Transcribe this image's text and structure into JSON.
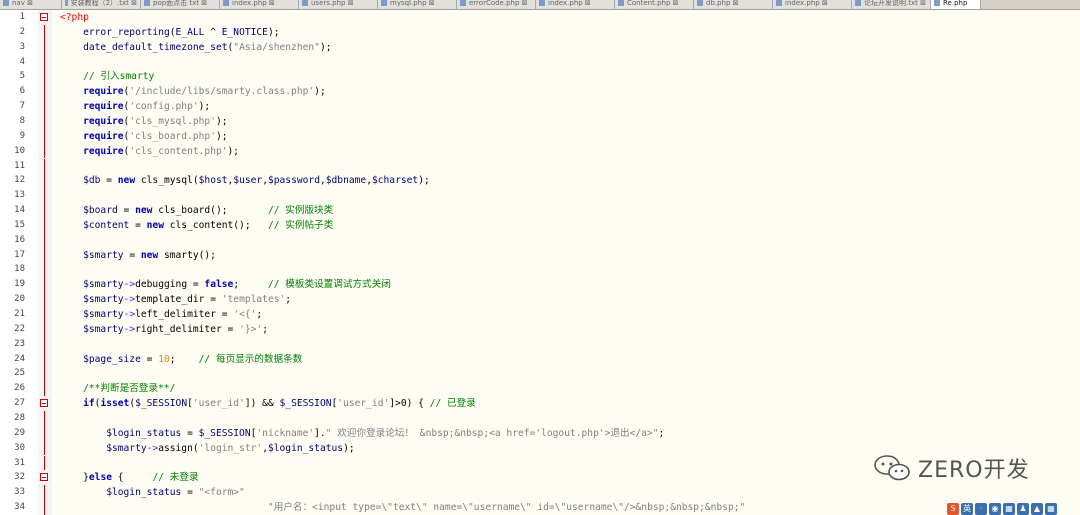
{
  "tabs": [
    {
      "label": "nav ⊠",
      "active": false
    },
    {
      "label": "安装教程（2）.txt ⊠",
      "active": false
    },
    {
      "label": "pop面点击 txt ⊠",
      "active": false
    },
    {
      "label": "index.php ⊠",
      "active": false
    },
    {
      "label": "users.php ⊠",
      "active": false
    },
    {
      "label": "mysql.php ⊠",
      "active": false
    },
    {
      "label": "errorCode.php ⊠",
      "active": false
    },
    {
      "label": "index.php ⊠",
      "active": false
    },
    {
      "label": "Content.php ⊠",
      "active": false
    },
    {
      "label": "db.php ⊠",
      "active": false
    },
    {
      "label": "index.php ⊠",
      "active": false
    },
    {
      "label": "论坛开发说明.txt ⊠",
      "active": false
    },
    {
      "label": "Re.php",
      "active": true
    }
  ],
  "lines": [
    {
      "n": "1",
      "segs": [
        [
          "tag",
          "<?php"
        ]
      ]
    },
    {
      "n": "2",
      "segs": [
        [
          "fn",
          "    error_reporting"
        ],
        [
          "",
          "("
        ],
        [
          "fn",
          "E_ALL"
        ],
        [
          "",
          " ^ "
        ],
        [
          "fn",
          "E_NOTICE"
        ],
        [
          "",
          ");"
        ]
      ]
    },
    {
      "n": "3",
      "segs": [
        [
          "fn",
          "    date_default_timezone_set"
        ],
        [
          "",
          "("
        ],
        [
          "str",
          "\"Asia/shenzhen\""
        ],
        [
          "",
          ");"
        ]
      ]
    },
    {
      "n": "4",
      "segs": []
    },
    {
      "n": "5",
      "segs": [
        [
          "cm",
          "    // 引入smarty"
        ]
      ]
    },
    {
      "n": "6",
      "segs": [
        [
          "kw",
          "    require"
        ],
        [
          "",
          "("
        ],
        [
          "str",
          "'/include/libs/smarty.class.php'"
        ],
        [
          "",
          ");"
        ]
      ]
    },
    {
      "n": "7",
      "segs": [
        [
          "kw",
          "    require"
        ],
        [
          "",
          "("
        ],
        [
          "str",
          "'config.php'"
        ],
        [
          "",
          ");"
        ]
      ]
    },
    {
      "n": "8",
      "segs": [
        [
          "kw",
          "    require"
        ],
        [
          "",
          "("
        ],
        [
          "str",
          "'cls_mysql.php'"
        ],
        [
          "",
          ");"
        ]
      ]
    },
    {
      "n": "9",
      "segs": [
        [
          "kw",
          "    require"
        ],
        [
          "",
          "("
        ],
        [
          "str",
          "'cls_board.php'"
        ],
        [
          "",
          ");"
        ]
      ]
    },
    {
      "n": "10",
      "segs": [
        [
          "kw",
          "    require"
        ],
        [
          "",
          "("
        ],
        [
          "str",
          "'cls_content.php'"
        ],
        [
          "",
          ");"
        ]
      ]
    },
    {
      "n": "11",
      "segs": []
    },
    {
      "n": "12",
      "segs": [
        [
          "var",
          "    $db"
        ],
        [
          "",
          " = "
        ],
        [
          "kw",
          "new"
        ],
        [
          "",
          " cls_mysql("
        ],
        [
          "var",
          "$host"
        ],
        [
          "",
          ","
        ],
        [
          "var",
          "$user"
        ],
        [
          "",
          ","
        ],
        [
          "var",
          "$password"
        ],
        [
          "",
          ","
        ],
        [
          "var",
          "$dbname"
        ],
        [
          "",
          ","
        ],
        [
          "var",
          "$charset"
        ],
        [
          "",
          ");"
        ]
      ]
    },
    {
      "n": "13",
      "segs": []
    },
    {
      "n": "14",
      "segs": [
        [
          "var",
          "    $board"
        ],
        [
          "",
          " = "
        ],
        [
          "kw",
          "new"
        ],
        [
          "",
          " cls_board();       "
        ],
        [
          "cm",
          "// 实例版块类"
        ]
      ]
    },
    {
      "n": "15",
      "segs": [
        [
          "var",
          "    $content"
        ],
        [
          "",
          " = "
        ],
        [
          "kw",
          "new"
        ],
        [
          "",
          " cls_content();   "
        ],
        [
          "cm",
          "// 实例帖子类"
        ]
      ]
    },
    {
      "n": "16",
      "segs": []
    },
    {
      "n": "17",
      "segs": [
        [
          "var",
          "    $smarty"
        ],
        [
          "",
          " = "
        ],
        [
          "kw",
          "new"
        ],
        [
          "",
          " smarty();"
        ]
      ]
    },
    {
      "n": "18",
      "segs": []
    },
    {
      "n": "19",
      "segs": [
        [
          "var",
          "    $smarty"
        ],
        [
          "op",
          "->"
        ],
        [
          "",
          "debugging = "
        ],
        [
          "kw",
          "false"
        ],
        [
          "",
          ";     "
        ],
        [
          "cm",
          "// 模板类设置调试方式关闭"
        ]
      ]
    },
    {
      "n": "20",
      "segs": [
        [
          "var",
          "    $smarty"
        ],
        [
          "op",
          "->"
        ],
        [
          "",
          "template_dir = "
        ],
        [
          "str",
          "'templates'"
        ],
        [
          "",
          ";"
        ]
      ]
    },
    {
      "n": "21",
      "segs": [
        [
          "var",
          "    $smarty"
        ],
        [
          "op",
          "->"
        ],
        [
          "",
          "left_delimiter = "
        ],
        [
          "str",
          "'<{'"
        ],
        [
          "",
          ";"
        ]
      ]
    },
    {
      "n": "22",
      "segs": [
        [
          "var",
          "    $smarty"
        ],
        [
          "op",
          "->"
        ],
        [
          "",
          "right_delimiter = "
        ],
        [
          "str",
          "'}>'"
        ],
        [
          "",
          ";"
        ]
      ]
    },
    {
      "n": "23",
      "segs": []
    },
    {
      "n": "24",
      "segs": [
        [
          "var",
          "    $page_size"
        ],
        [
          "",
          " = "
        ],
        [
          "num",
          "10"
        ],
        [
          "",
          ";    "
        ],
        [
          "cm",
          "// 每页显示的数据条数"
        ]
      ]
    },
    {
      "n": "25",
      "segs": []
    },
    {
      "n": "26",
      "segs": [
        [
          "cm",
          "    /**判断是否登录**/"
        ]
      ]
    },
    {
      "n": "27",
      "segs": [
        [
          "kw",
          "    if"
        ],
        [
          "",
          "("
        ],
        [
          "kw",
          "isset"
        ],
        [
          "",
          "("
        ],
        [
          "var",
          "$_SESSION"
        ],
        [
          "",
          "["
        ],
        [
          "str",
          "'user_id'"
        ],
        [
          "",
          "]) && "
        ],
        [
          "var",
          "$_SESSION"
        ],
        [
          "",
          "["
        ],
        [
          "str",
          "'user_id'"
        ],
        [
          "",
          "]>0) { "
        ],
        [
          "cm",
          "// 已登录"
        ]
      ]
    },
    {
      "n": "28",
      "segs": []
    },
    {
      "n": "29",
      "segs": [
        [
          "var",
          "        $login_status"
        ],
        [
          "",
          " = "
        ],
        [
          "var",
          "$_SESSION"
        ],
        [
          "",
          "["
        ],
        [
          "str",
          "'nickname'"
        ],
        [
          "",
          "]."
        ],
        [
          "str",
          "\" 欢迎你登录论坛！ &nbsp;&nbsp;<a href='logout.php'>退出</a>\""
        ],
        [
          "",
          ";"
        ]
      ]
    },
    {
      "n": "30",
      "segs": [
        [
          "var",
          "        $smarty"
        ],
        [
          "op",
          "->"
        ],
        [
          "",
          "assign("
        ],
        [
          "str",
          "'login_str'"
        ],
        [
          "",
          ","
        ],
        [
          "var",
          "$login_status"
        ],
        [
          "",
          ");"
        ]
      ]
    },
    {
      "n": "31",
      "segs": []
    },
    {
      "n": "32",
      "segs": [
        [
          "",
          "    }"
        ],
        [
          "kw",
          "else"
        ],
        [
          "",
          " {     "
        ],
        [
          "cm",
          "// 未登录"
        ]
      ]
    },
    {
      "n": "33",
      "segs": [
        [
          "var",
          "        $login_status"
        ],
        [
          "",
          " = "
        ],
        [
          "str",
          "\"<form>\""
        ]
      ]
    },
    {
      "n": "34",
      "segs": [
        [
          "str",
          "                                    \"用户名：<input type=\\\"text\\\" name=\\\"username\\\" id=\\\"username\\\"/>&nbsp;&nbsp;&nbsp;\""
        ]
      ]
    }
  ],
  "watermark": {
    "text": "ZERO开发",
    "icon": "wechat-icon"
  },
  "tray": [
    {
      "icon": "app-s-icon",
      "label": "S",
      "color": "#e8532c"
    },
    {
      "icon": "ime-icon",
      "label": "英",
      "color": "#3a6fb0"
    },
    {
      "icon": "moon-icon",
      "label": "·",
      "color": "#3a6fb0"
    },
    {
      "icon": "mic-icon",
      "label": "◉",
      "color": "#3a6fb0"
    },
    {
      "icon": "keyboard-icon",
      "label": "▦",
      "color": "#3a6fb0"
    },
    {
      "icon": "user-icon",
      "label": "♟",
      "color": "#3a6fb0"
    },
    {
      "icon": "shirt-icon",
      "label": "▲",
      "color": "#3a6fb0"
    },
    {
      "icon": "grid-icon",
      "label": "▦",
      "color": "#3a6fb0"
    }
  ]
}
